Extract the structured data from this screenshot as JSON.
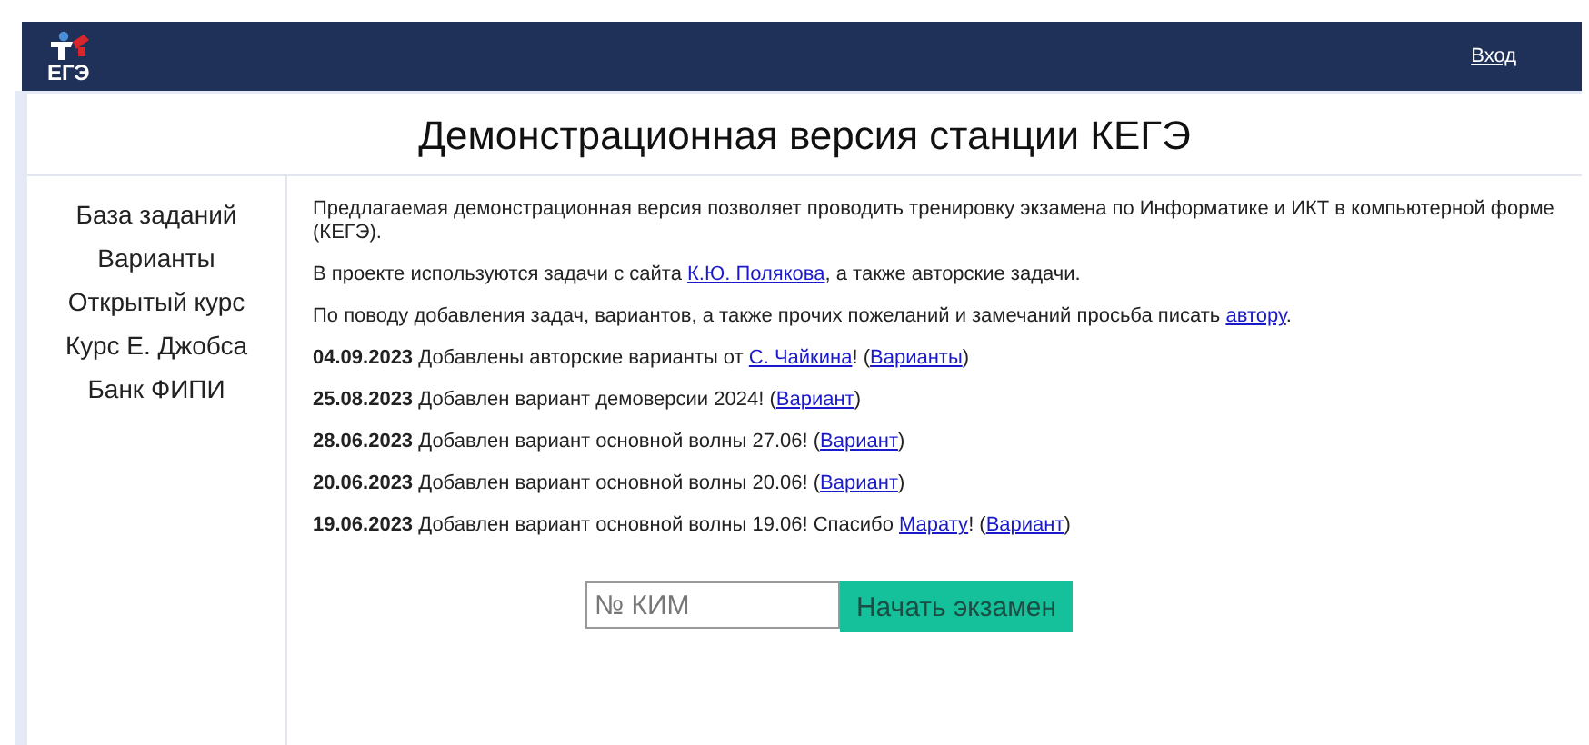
{
  "header": {
    "logo_text": "ЕГЭ",
    "login_link": "Вход"
  },
  "title": "Демонстрационная версия станции КЕГЭ",
  "sidebar": {
    "items": [
      {
        "label": "База заданий"
      },
      {
        "label": "Варианты"
      },
      {
        "label": "Открытый курс"
      },
      {
        "label": "Курс Е. Джобса"
      },
      {
        "label": "Банк ФИПИ"
      }
    ]
  },
  "intro": [
    [
      {
        "kind": "text",
        "text": "Предлагаемая демонстрационная версия позволяет проводить тренировку экзамена по Информатике и ИКТ в компьютерной форме (КЕГЭ)."
      }
    ],
    [
      {
        "kind": "text",
        "text": "В проекте используются задачи с сайта "
      },
      {
        "kind": "link",
        "text": "К.Ю. Полякова"
      },
      {
        "kind": "text",
        "text": ", а также авторские задачи."
      }
    ],
    [
      {
        "kind": "text",
        "text": "По поводу добавления задач, вариантов, а также прочих пожеланий и замечаний просьба писать "
      },
      {
        "kind": "link",
        "text": "автору"
      },
      {
        "kind": "text",
        "text": "."
      }
    ]
  ],
  "news": [
    {
      "date": "04.09.2023",
      "parts": [
        {
          "kind": "text",
          "text": " Добавлены авторские варианты от "
        },
        {
          "kind": "link",
          "text": "С. Чайкина"
        },
        {
          "kind": "text",
          "text": "! ("
        },
        {
          "kind": "link",
          "text": "Варианты"
        },
        {
          "kind": "text",
          "text": ")"
        }
      ]
    },
    {
      "date": "25.08.2023",
      "parts": [
        {
          "kind": "text",
          "text": " Добавлен вариант демоверсии 2024! ("
        },
        {
          "kind": "link",
          "text": "Вариант"
        },
        {
          "kind": "text",
          "text": ")"
        }
      ]
    },
    {
      "date": "28.06.2023",
      "parts": [
        {
          "kind": "text",
          "text": " Добавлен вариант основной волны 27.06! ("
        },
        {
          "kind": "link",
          "text": "Вариант"
        },
        {
          "kind": "text",
          "text": ")"
        }
      ]
    },
    {
      "date": "20.06.2023",
      "parts": [
        {
          "kind": "text",
          "text": " Добавлен вариант основной волны 20.06! ("
        },
        {
          "kind": "link",
          "text": "Вариант"
        },
        {
          "kind": "text",
          "text": ")"
        }
      ]
    },
    {
      "date": "19.06.2023",
      "parts": [
        {
          "kind": "text",
          "text": " Добавлен вариант основной волны 19.06! Спасибо "
        },
        {
          "kind": "link",
          "text": "Марату"
        },
        {
          "kind": "text",
          "text": "! ("
        },
        {
          "kind": "link",
          "text": "Вариант"
        },
        {
          "kind": "text",
          "text": ")"
        }
      ]
    }
  ],
  "exam_form": {
    "placeholder": "№ КИМ",
    "button": "Начать экзамен"
  }
}
